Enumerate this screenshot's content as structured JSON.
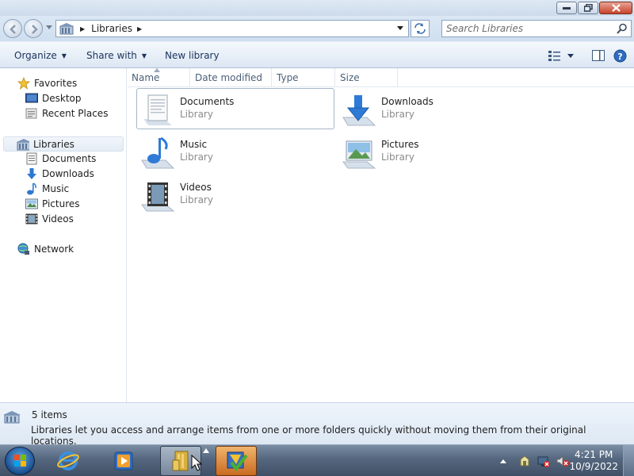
{
  "window": {
    "address_crumb": "Libraries",
    "search_placeholder": "Search Libraries"
  },
  "toolbar": {
    "organize": "Organize",
    "share_with": "Share with",
    "new_library": "New library"
  },
  "nav": {
    "favorites": "Favorites",
    "desktop": "Desktop",
    "recent_places": "Recent Places",
    "libraries": "Libraries",
    "documents": "Documents",
    "downloads": "Downloads",
    "music": "Music",
    "pictures": "Pictures",
    "videos": "Videos",
    "network": "Network"
  },
  "columns": {
    "name": "Name",
    "date_modified": "Date modified",
    "type": "Type",
    "size": "Size"
  },
  "items": [
    {
      "name": "Documents",
      "type": "Library",
      "icon": "documents-library-icon"
    },
    {
      "name": "Downloads",
      "type": "Library",
      "icon": "downloads-library-icon"
    },
    {
      "name": "Music",
      "type": "Library",
      "icon": "music-library-icon"
    },
    {
      "name": "Pictures",
      "type": "Library",
      "icon": "pictures-library-icon"
    },
    {
      "name": "Videos",
      "type": "Library",
      "icon": "videos-library-icon"
    }
  ],
  "details": {
    "count": "5 items",
    "description": "Libraries let you access and arrange items from one or more folders quickly without moving them from their original locations."
  },
  "taskbar": {
    "time": "4:21 PM",
    "date": "10/9/2022"
  },
  "colors": {
    "accent": "#1e3560",
    "selection_border": "#a6b6c9"
  }
}
